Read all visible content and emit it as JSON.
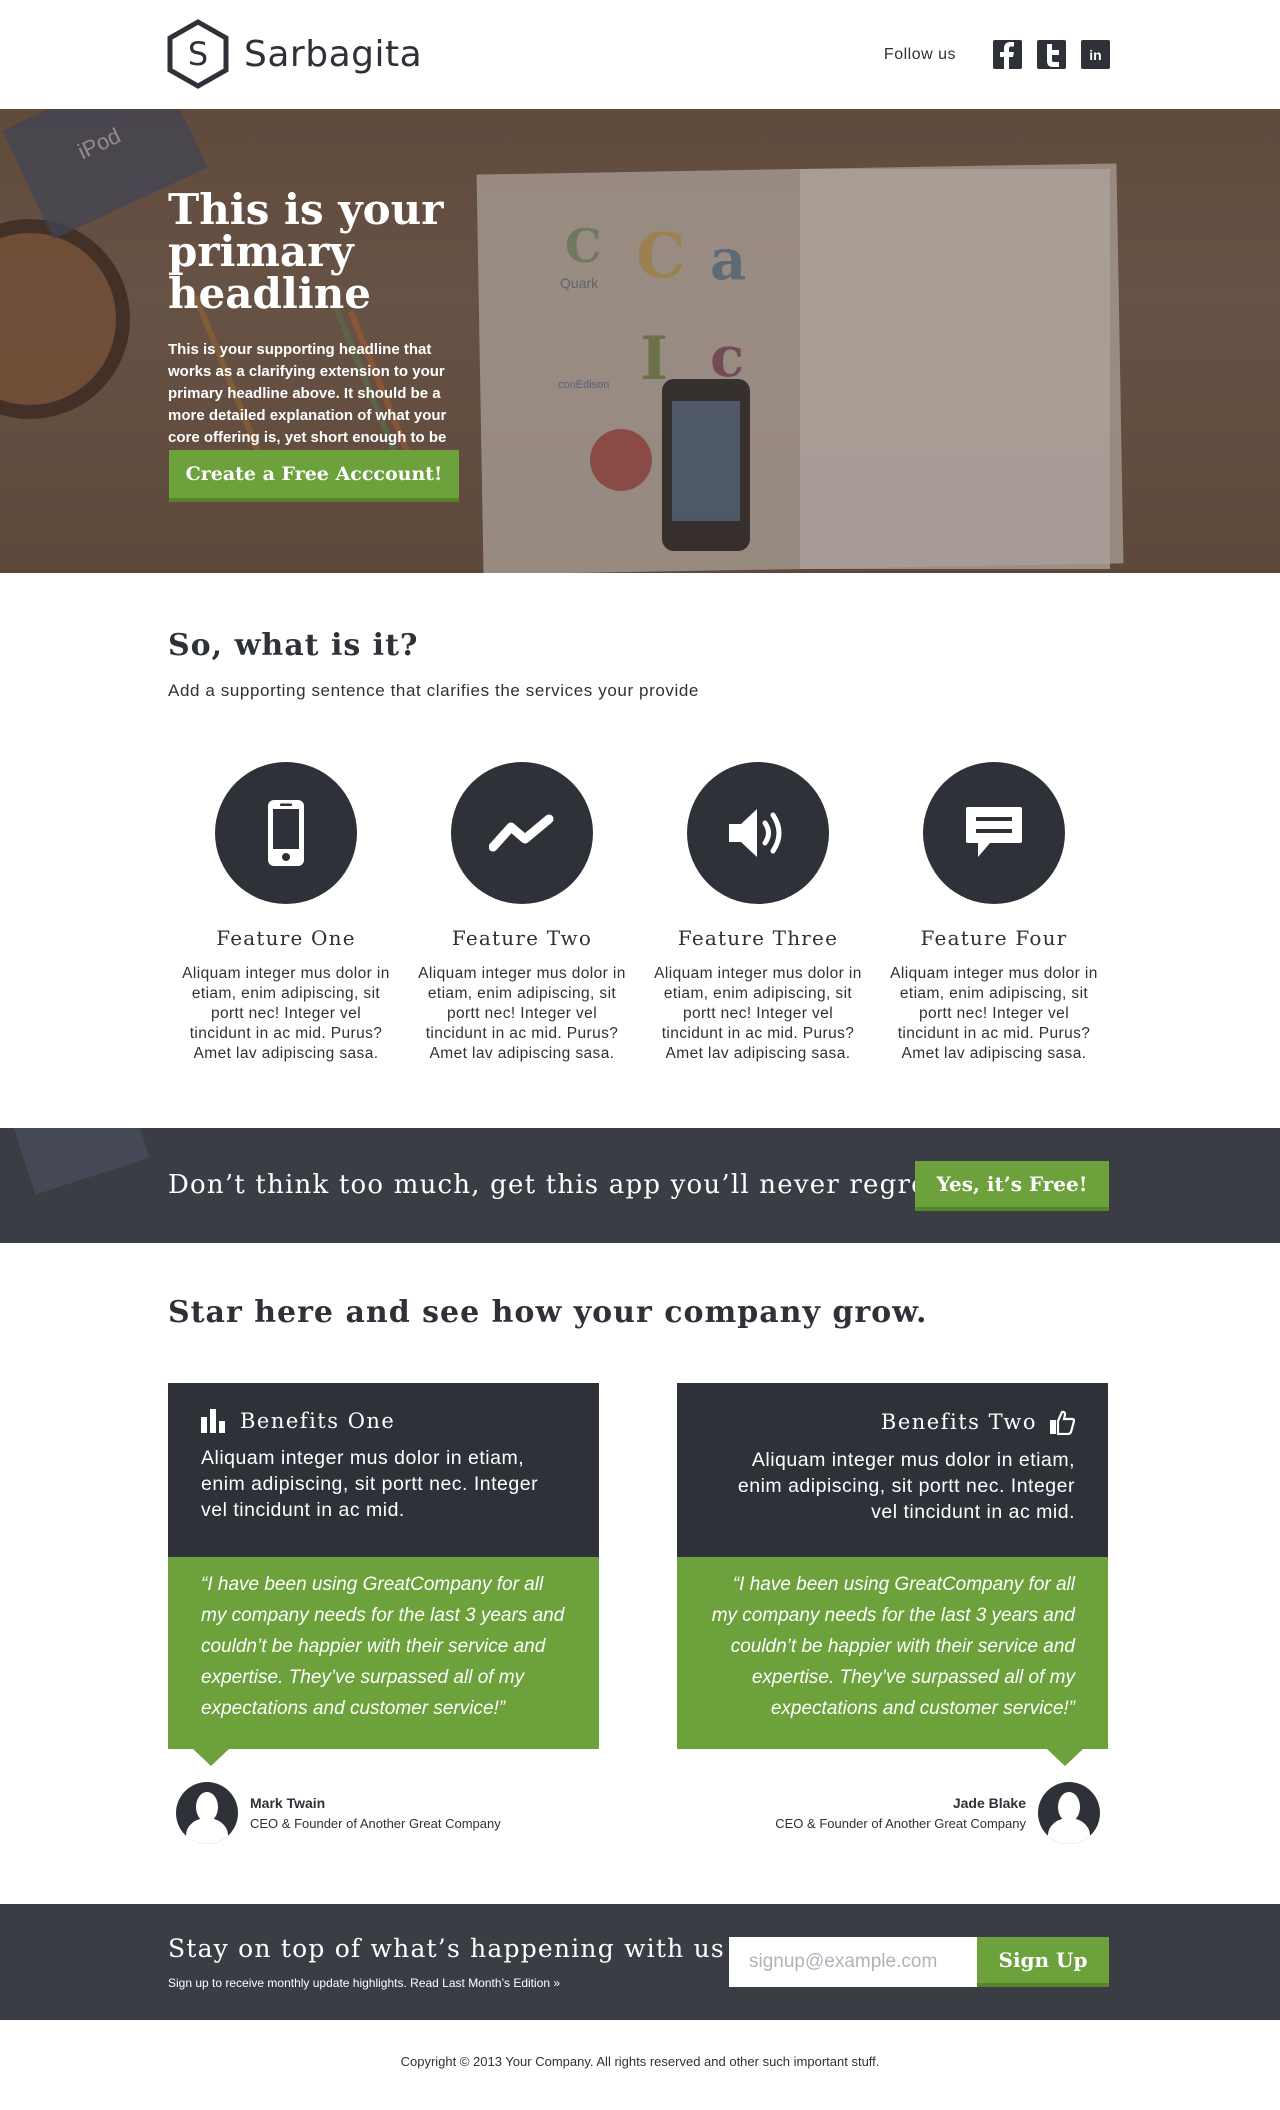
{
  "brand": {
    "name": "Sarbagita",
    "logo_letter": "S"
  },
  "header": {
    "follow_label": "Follow us",
    "social": [
      {
        "name": "facebook",
        "glyph": "f"
      },
      {
        "name": "twitter",
        "glyph": "t"
      },
      {
        "name": "linkedin",
        "glyph": "in"
      }
    ]
  },
  "hero": {
    "title_line1": "This is your",
    "title_line2": "primary headline",
    "subtitle": "This is your supporting headline that works as a clarifying extension to your primary headline above. It should be a more detailed explanation of what your core offering is, yet short enough to be read quickly.",
    "cta": "Create a Free Acccount!",
    "image_text": {
      "quark": "Quark",
      "conedison": "conEdison",
      "ipod": "iPod"
    }
  },
  "what": {
    "title": "So, what is it?",
    "subtitle": "Add a supporting sentence that clarifies the services your provide",
    "features": [
      {
        "title": "Feature One",
        "icon": "mobile-phone-icon",
        "text": "Aliquam integer mus dolor in etiam, enim adipiscing, sit portt nec! Integer vel tincidunt in ac mid. Purus? Amet lav adipiscing sasa."
      },
      {
        "title": "Feature Two",
        "icon": "trend-line-icon",
        "text": "Aliquam integer mus dolor in etiam, enim adipiscing, sit portt nec! Integer vel tincidunt in ac mid. Purus? Amet lav adipiscing sasa."
      },
      {
        "title": "Feature Three",
        "icon": "speaker-volume-icon",
        "text": "Aliquam integer mus dolor in etiam, enim adipiscing, sit portt nec! Integer vel tincidunt in ac mid. Purus? Amet lav adipiscing sasa."
      },
      {
        "title": "Feature Four",
        "icon": "chat-bubble-icon",
        "text": "Aliquam integer mus dolor in etiam, enim adipiscing, sit portt nec! Integer vel tincidunt in ac mid. Purus? Amet lav adipiscing sasa."
      }
    ]
  },
  "band": {
    "text": "Don’t think too much, get this app you’ll never regret",
    "cta": "Yes, it’s Free!"
  },
  "benefits": {
    "title": "Star here and see how your company grow.",
    "items": [
      {
        "title": "Benefits One",
        "icon": "bar-chart-icon",
        "body": "Aliquam integer mus dolor in etiam, enim adipiscing, sit portt nec. Integer vel tincidunt in ac mid.",
        "quote": "“I have been using GreatCompany for all my company needs for the last 3 years and couldn’t be happier with their service and expertise. They’ve surpassed all of my expectations and customer service!”",
        "author_name": "Mark Twain",
        "author_role": "CEO & Founder of Another Great Company"
      },
      {
        "title": "Benefits Two",
        "icon": "thumbs-up-icon",
        "body": "Aliquam integer mus dolor in etiam, enim adipiscing, sit portt nec. Integer vel tincidunt in ac mid.",
        "quote": "“I have been using GreatCompany for all my company needs for the last 3 years and couldn’t be happier with their service and expertise. They’ve surpassed all of my expectations and customer service!”",
        "author_name": "Jade Blake",
        "author_role": "CEO & Founder of Another Great Company"
      }
    ]
  },
  "newsletter": {
    "title": "Stay on top of what’s happening with us",
    "subtitle": "Sign up to receive monthly update highlights. Read Last Month’s Edition »",
    "placeholder": "signup@example.com",
    "cta": "Sign Up"
  },
  "footer": {
    "copyright": "Copyright © 2013 Your Company. All rights reserved and other such important stuff."
  },
  "colors": {
    "dark": "#2e3138",
    "green": "#6ca13b",
    "green_shadow": "#56842a",
    "band": "#3a3d44",
    "white": "#ffffff"
  }
}
